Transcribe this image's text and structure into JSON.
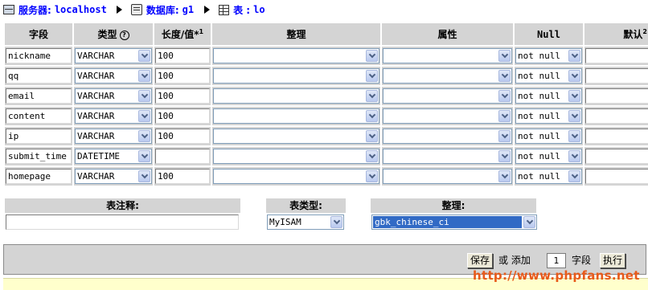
{
  "breadcrumb": {
    "server_label": "服务器:",
    "server_value": "localhost",
    "db_label": "数据库:",
    "db_value": "g1",
    "table_label": "表 :",
    "table_value": "lo"
  },
  "columns": {
    "field": "字段",
    "type": "类型",
    "type_help": "?",
    "length": "长度/值*",
    "length_sup": "1",
    "collation": "整理",
    "attributes": "属性",
    "null": "Null",
    "default": "默认",
    "default_sup": "2"
  },
  "rows": [
    {
      "name": "nickname",
      "type": "VARCHAR",
      "length": "100",
      "collation": "",
      "attributes": "",
      "null": "not null",
      "default": ""
    },
    {
      "name": "qq",
      "type": "VARCHAR",
      "length": "100",
      "collation": "",
      "attributes": "",
      "null": "not null",
      "default": ""
    },
    {
      "name": "email",
      "type": "VARCHAR",
      "length": "100",
      "collation": "",
      "attributes": "",
      "null": "not null",
      "default": ""
    },
    {
      "name": "content",
      "type": "VARCHAR",
      "length": "100",
      "collation": "",
      "attributes": "",
      "null": "not null",
      "default": ""
    },
    {
      "name": "ip",
      "type": "VARCHAR",
      "length": "100",
      "collation": "",
      "attributes": "",
      "null": "not null",
      "default": ""
    },
    {
      "name": "submit_time",
      "type": "DATETIME",
      "length": "",
      "collation": "",
      "attributes": "",
      "null": "not null",
      "default": ""
    },
    {
      "name": "homepage",
      "type": "VARCHAR",
      "length": "100",
      "collation": "",
      "attributes": "",
      "null": "not null",
      "default": ""
    }
  ],
  "table_options": {
    "comment_label": "表注释:",
    "comment_value": "",
    "engine_label": "表类型:",
    "engine_value": "MyISAM",
    "collation_label": "整理:",
    "collation_value": "gbk_chinese_ci"
  },
  "footer": {
    "save_label": "保存",
    "or_add_label": "或 添加",
    "add_count": "1",
    "fields_label": "字段",
    "go_label": "执行"
  },
  "watermark": "http://www.phpfans.net",
  "icons": {
    "server": "server-icon",
    "database": "database-icon",
    "table": "table-icon",
    "separator": "arrow-right-icon"
  },
  "colors": {
    "link": "#0000ff",
    "header_bg": "#d4d4d4",
    "selection": "#316ac5"
  }
}
